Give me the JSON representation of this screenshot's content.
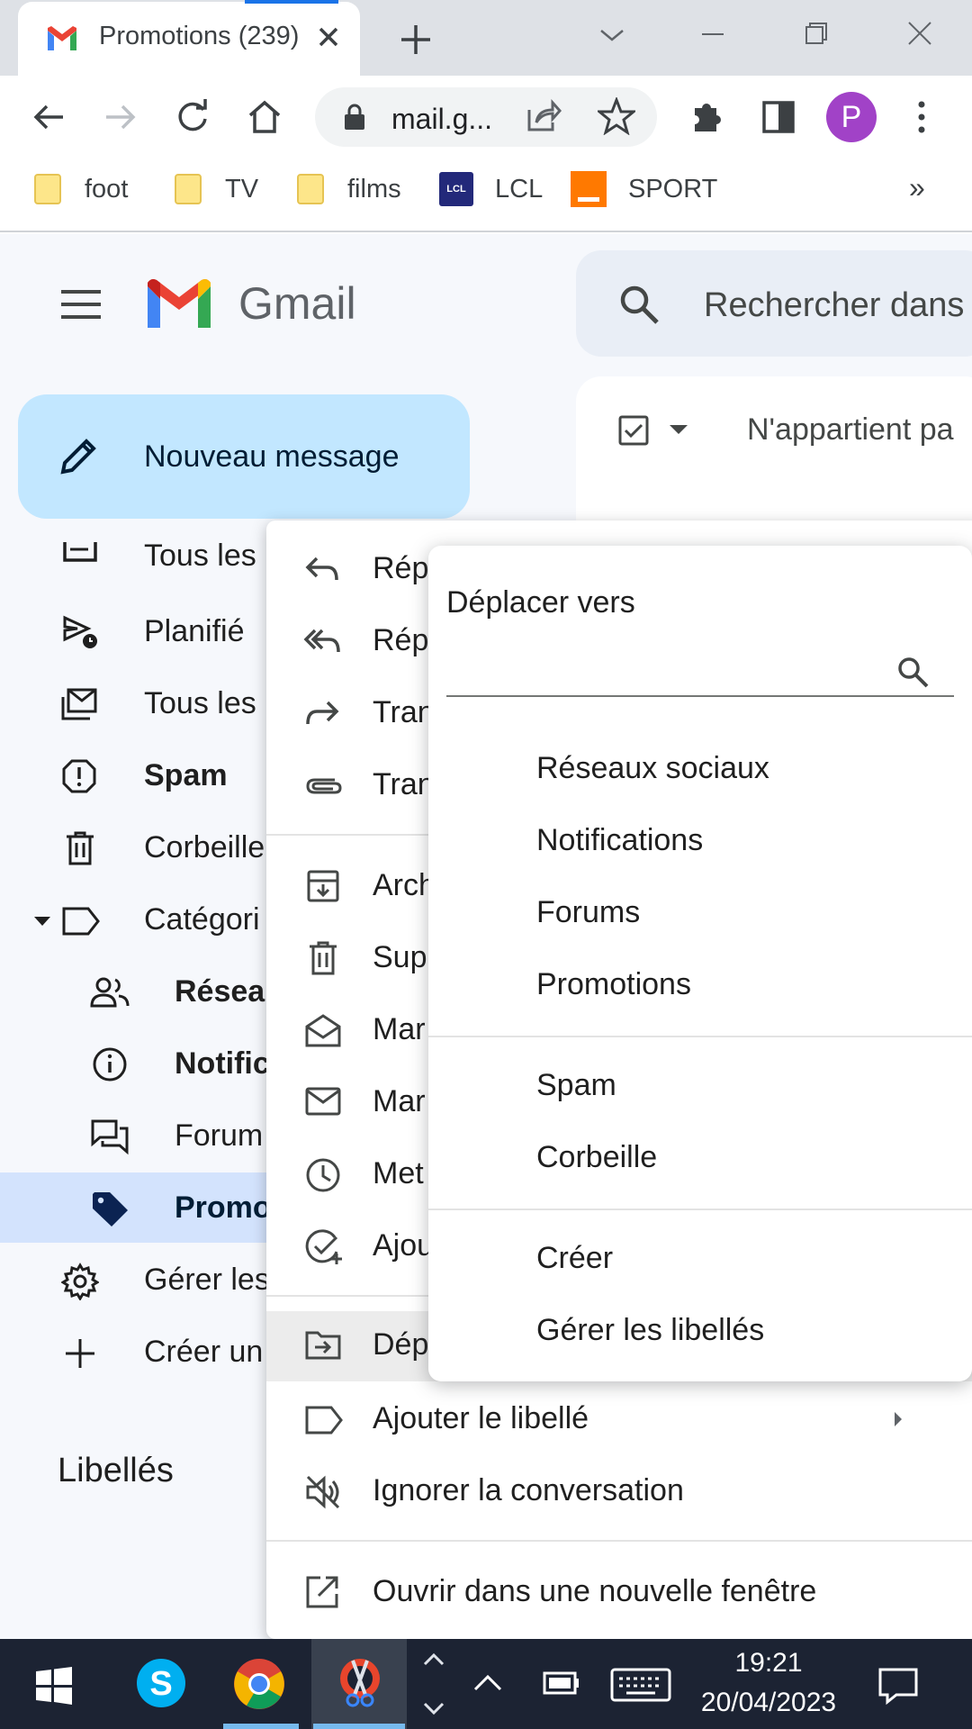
{
  "browser": {
    "tab_title": "Promotions (239)",
    "url": "mail.g...",
    "profile_initial": "P",
    "bookmarks": [
      {
        "label": "foot",
        "icon": "folder-icon"
      },
      {
        "label": "TV",
        "icon": "folder-icon"
      },
      {
        "label": "films",
        "icon": "folder-icon"
      },
      {
        "label": "LCL",
        "icon": "lcl-logo"
      },
      {
        "label": "SPORT",
        "icon": "orange-logo"
      }
    ],
    "bookmarks_overflow": "»"
  },
  "gmail": {
    "logo_text": "Gmail",
    "search_placeholder": "Rechercher dans",
    "compose_label": "Nouveau message",
    "main_toolbar_text": "N'appartient pa",
    "libelles_heading": "Libellés"
  },
  "sidebar": {
    "items": [
      {
        "label": "Tous les",
        "icon": "all-mail-icon"
      },
      {
        "label": "Planifié",
        "icon": "scheduled-icon"
      },
      {
        "label": "Tous les",
        "icon": "all-mail-icon"
      },
      {
        "label": "Spam",
        "icon": "spam-icon",
        "bold": true
      },
      {
        "label": "Corbeille",
        "icon": "trash-icon"
      },
      {
        "label": "Catégori",
        "icon": "label-icon"
      },
      {
        "label": "Résea",
        "icon": "people-icon",
        "bold": true
      },
      {
        "label": "Notific",
        "icon": "info-icon",
        "bold": true
      },
      {
        "label": "Forum",
        "icon": "forum-icon"
      },
      {
        "label": "Promo",
        "icon": "tag-icon",
        "bold": true,
        "selected": true
      },
      {
        "label": "Gérer les",
        "icon": "gear-icon"
      },
      {
        "label": "Créer un",
        "icon": "plus-icon"
      }
    ]
  },
  "context_menu": {
    "items": [
      {
        "label": "Rép",
        "icon": "reply-icon"
      },
      {
        "label": "Rép",
        "icon": "reply-all-icon"
      },
      {
        "label": "Tran",
        "icon": "forward-icon"
      },
      {
        "label": "Tran",
        "icon": "attachment-icon"
      },
      {
        "label": "Arch",
        "icon": "archive-icon"
      },
      {
        "label": "Sup",
        "icon": "delete-icon"
      },
      {
        "label": "Mar",
        "icon": "mark-read-icon"
      },
      {
        "label": "Mar",
        "icon": "mark-unread-icon"
      },
      {
        "label": "Met",
        "icon": "snooze-icon"
      },
      {
        "label": "Ajou",
        "icon": "add-task-icon"
      },
      {
        "label": "Dép",
        "icon": "move-to-icon"
      },
      {
        "label": "Ajouter le libellé",
        "icon": "label-icon"
      },
      {
        "label": "Ignorer la conversation",
        "icon": "mute-icon"
      },
      {
        "label": "Ouvrir dans une nouvelle fenêtre",
        "icon": "open-new-window-icon"
      }
    ]
  },
  "submenu": {
    "title": "Déplacer vers",
    "categories": [
      "Réseaux sociaux",
      "Notifications",
      "Forums",
      "Promotions"
    ],
    "system": [
      "Spam",
      "Corbeille"
    ],
    "actions": [
      "Créer",
      "Gérer les libellés"
    ]
  },
  "taskbar": {
    "time": "19:21",
    "date": "20/04/2023"
  },
  "colors": {
    "compose_bg": "#c2e7ff",
    "selected_nav_bg": "#d3e3fd",
    "avatar_bg": "#a142c7",
    "taskbar_bg": "#1c2333"
  }
}
